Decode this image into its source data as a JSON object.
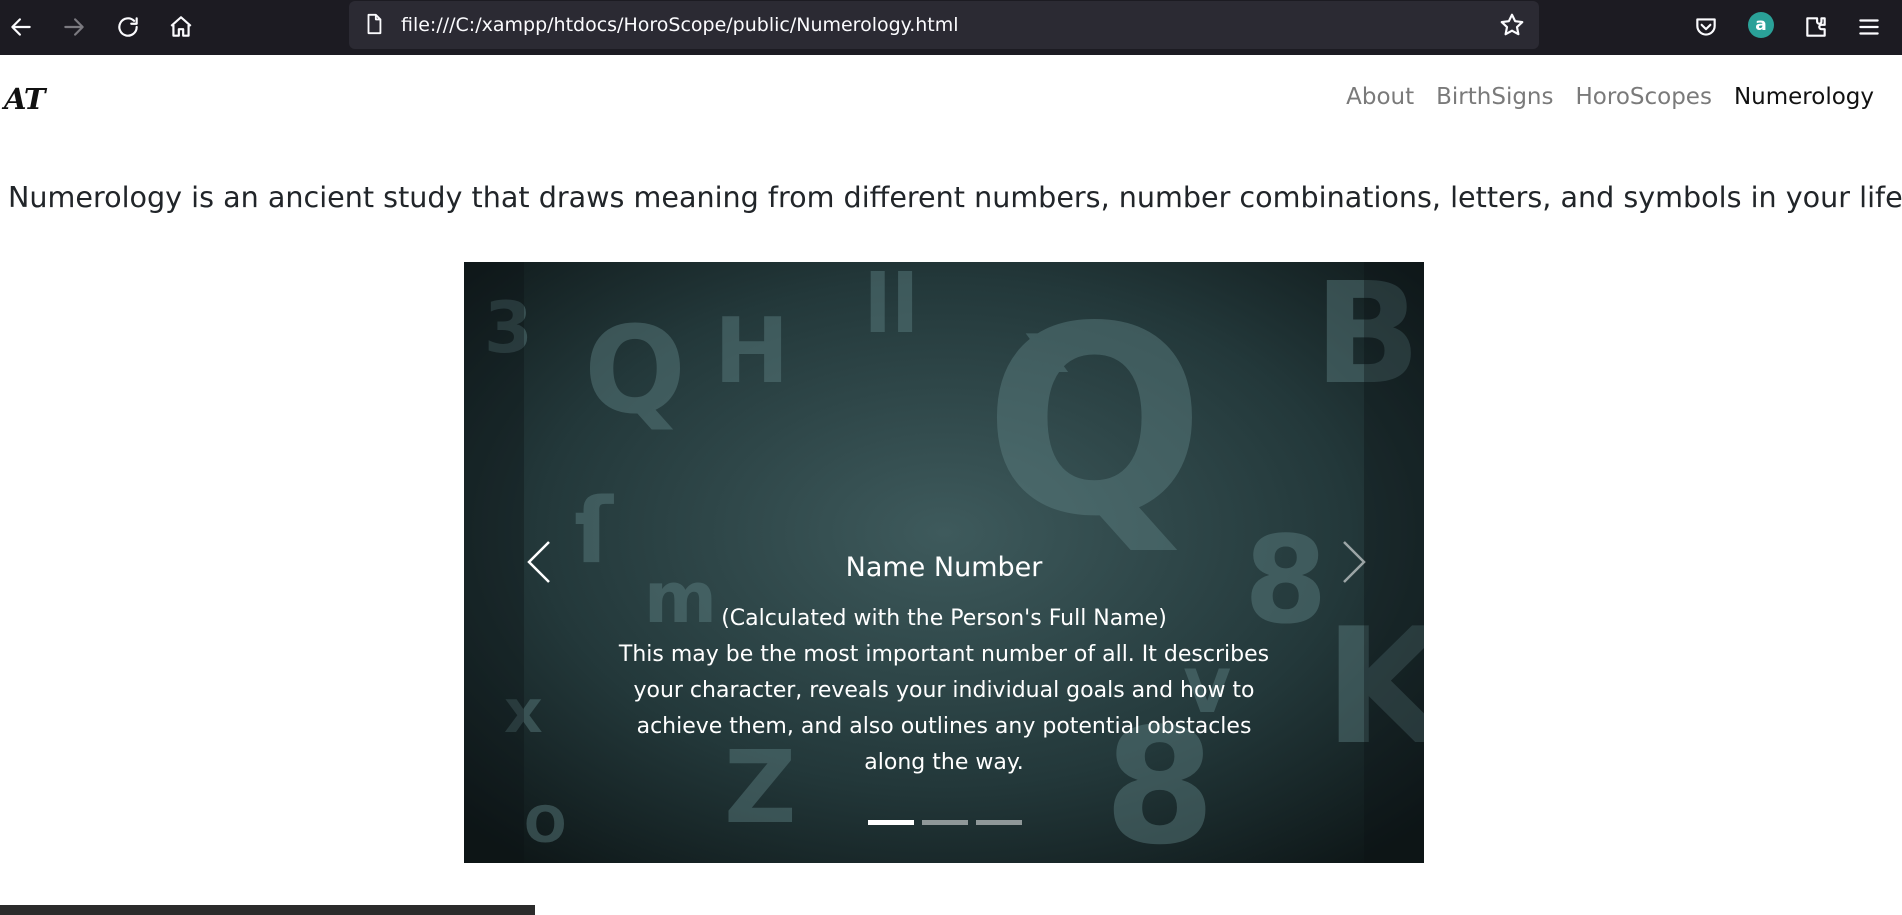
{
  "browser": {
    "url": "file:///C:/xampp/htdocs/HoroScope/public/Numerology.html",
    "extension_avatar_letter": "a",
    "icons": [
      "back-arrow-icon",
      "forward-arrow-icon",
      "reload-icon",
      "home-icon",
      "page-icon",
      "bookmark-star-icon",
      "pocket-icon",
      "extensions-icon",
      "menu-icon"
    ]
  },
  "header": {
    "brand": "AT",
    "nav": [
      {
        "label": "About",
        "active": false
      },
      {
        "label": "BirthSigns",
        "active": false
      },
      {
        "label": "HoroScopes",
        "active": false
      },
      {
        "label": "Numerology",
        "active": true
      }
    ]
  },
  "main": {
    "intro": "Numerology is an ancient study that draws meaning from different numbers, number combinations, letters, and symbols in your life.",
    "carousel": {
      "title": "Name Number",
      "subtitle": "(Calculated with the Person's Full Name)",
      "body": "This may be the most important number of all. It describes your character, reveals your individual goals and how to achieve them, and also outlines any potential obstacles along the way.",
      "slide_count": 3,
      "active_slide": 1
    }
  },
  "colors": {
    "toolbar_bg": "#1c1b22",
    "urlbar_bg": "#2b2a33",
    "text": "#212529",
    "nav_inactive": "#7a7a7a",
    "nav_active": "#111111",
    "carousel_bg": "#1b2628",
    "avatar": "#2aa198"
  }
}
